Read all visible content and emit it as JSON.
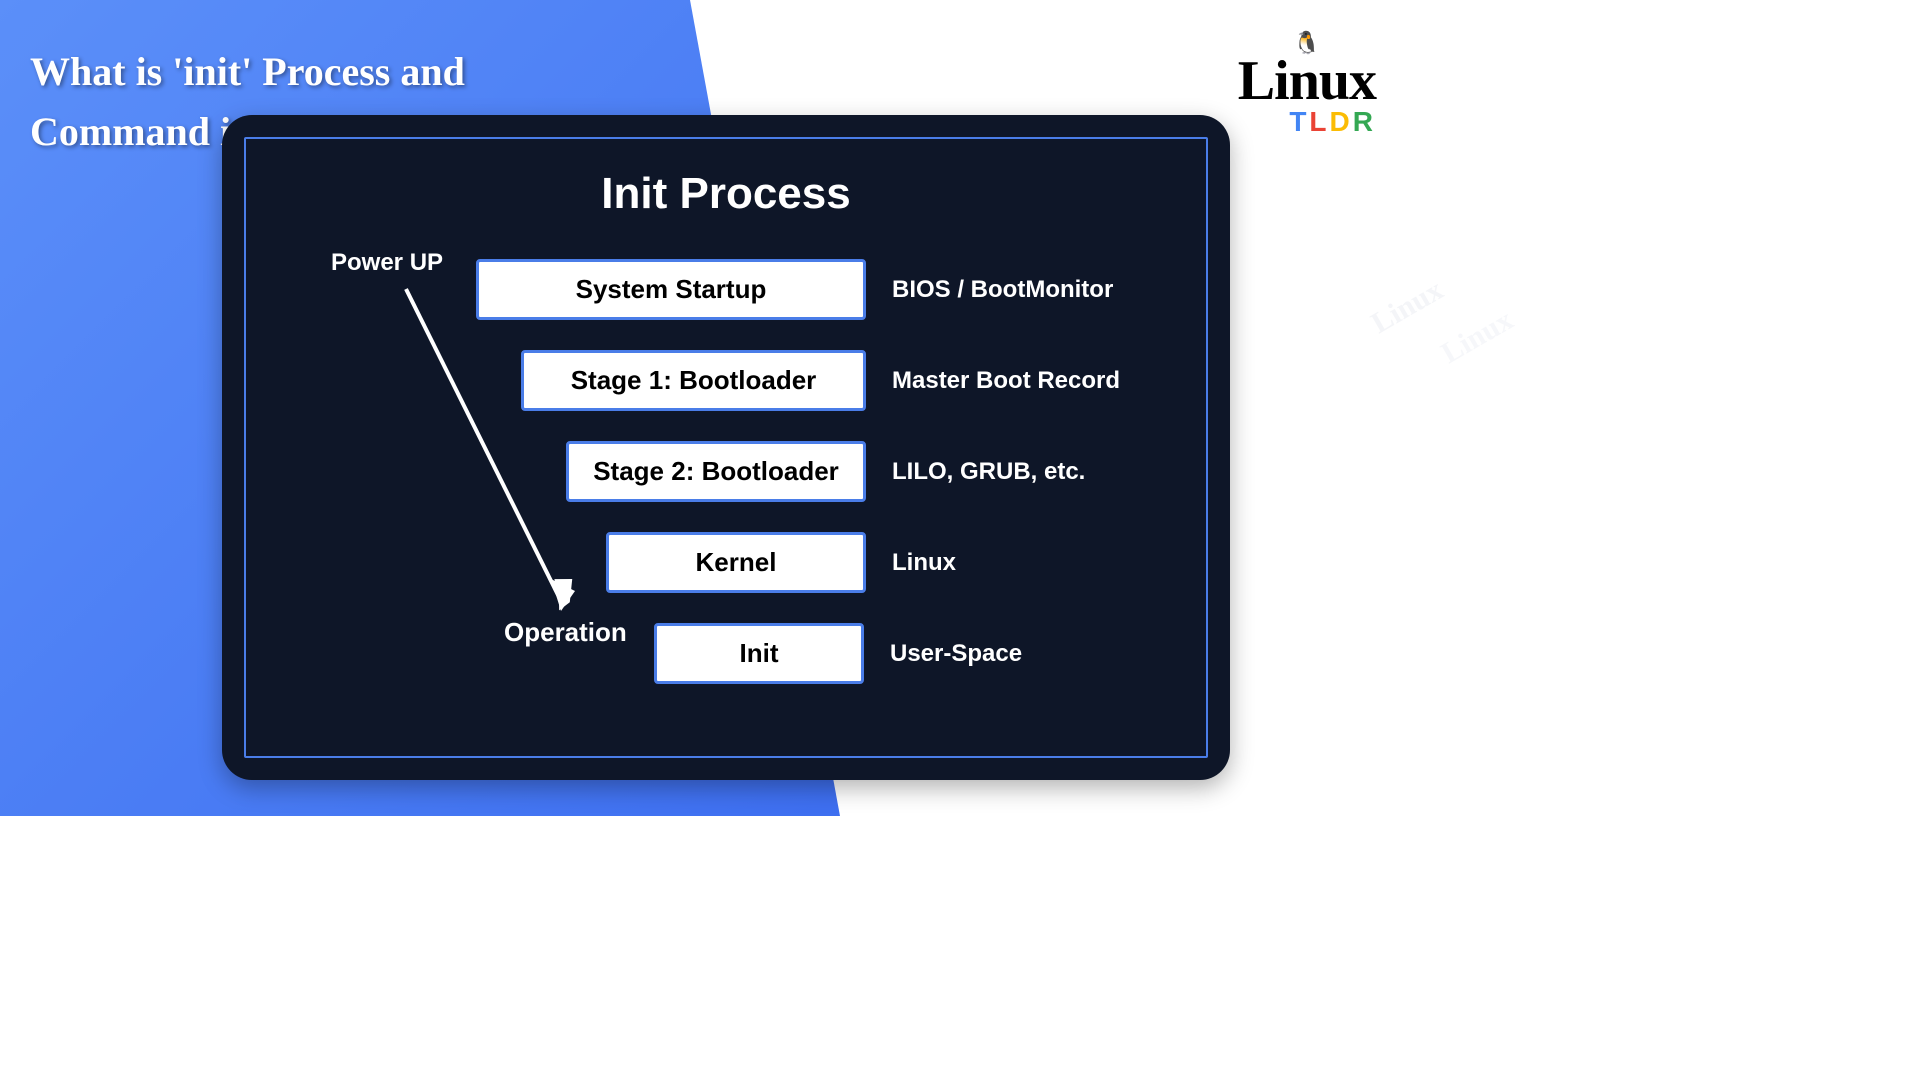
{
  "title": "What is 'init' Process and Command in Linux?",
  "logo": {
    "main": "Linux",
    "sub_t": "T",
    "sub_l": "L",
    "sub_d": "D",
    "sub_r": "R"
  },
  "panel": {
    "title": "Init Process",
    "arrow_start": "Power UP",
    "arrow_end": "Operation",
    "stages": [
      {
        "box": "System Startup",
        "label": "BIOS / BootMonitor"
      },
      {
        "box": "Stage 1: Bootloader",
        "label": "Master Boot Record"
      },
      {
        "box": "Stage 2: Bootloader",
        "label": "LILO, GRUB, etc."
      },
      {
        "box": "Kernel",
        "label": "Linux"
      },
      {
        "box": "Init",
        "label": "User-Space"
      }
    ]
  },
  "watermark": "Linux"
}
